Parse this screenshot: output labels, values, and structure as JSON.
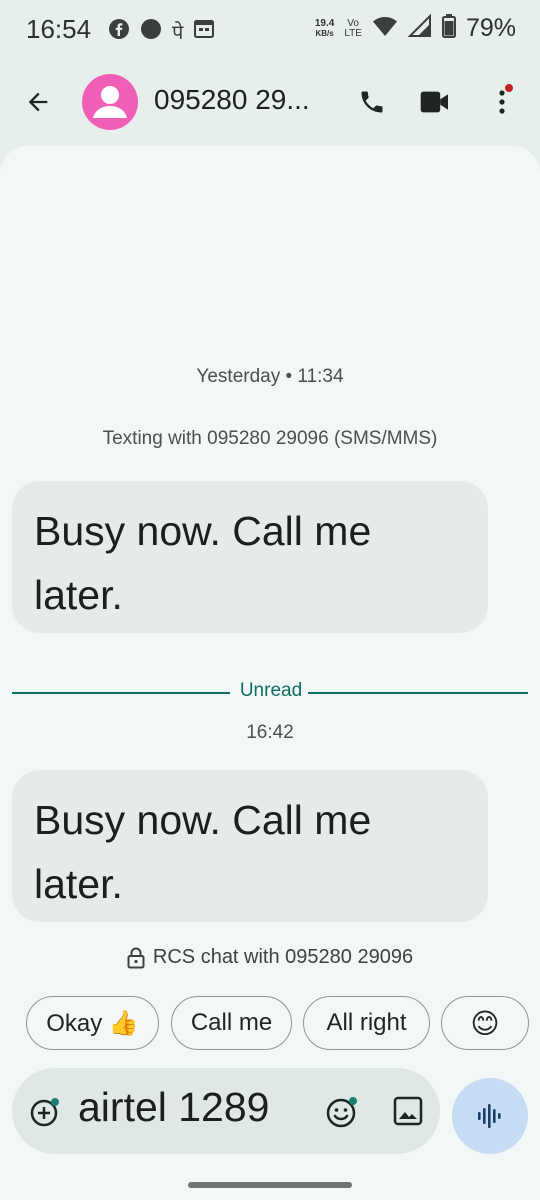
{
  "status_bar": {
    "time": "16:54",
    "net_speed_value": "19.4",
    "net_speed_unit": "KB/s",
    "volte_top": "Vo",
    "volte_bottom": "LTE",
    "battery": "79%",
    "indicator_glyph": "पे",
    "icons": [
      "facebook-icon",
      "dot-icon",
      "phonepe-icon",
      "calendar-icon",
      "wifi-icon",
      "signal-icon",
      "battery-icon"
    ]
  },
  "app_bar": {
    "title": "095280 29...",
    "avatar_color": "#f05fb7",
    "icons": [
      "back-arrow-icon",
      "phone-icon",
      "video-camera-icon",
      "more-vert-icon"
    ]
  },
  "conversation": {
    "first_timestamp": "Yesterday • 11:34",
    "texting_info": "Texting with 095280 29096 (SMS/MMS)",
    "messages": [
      {
        "text": "Busy now. Call me later.",
        "direction": "incoming"
      },
      {
        "text": "Busy now. Call me later.",
        "direction": "incoming"
      }
    ],
    "unread_label": "Unread",
    "second_timestamp": "16:42",
    "rcs_info": "RCS chat with 095280 29096"
  },
  "smart_replies": [
    {
      "label": "Okay 👍"
    },
    {
      "label": "Call me"
    },
    {
      "label": "All right"
    },
    {
      "label": "😊"
    }
  ],
  "compose": {
    "value": "airtel 1289",
    "icons": [
      "add-attachment-icon",
      "emoji-icon",
      "gallery-icon",
      "voice-icon"
    ]
  },
  "colors": {
    "accent": "#116d62",
    "background": "#e7efec",
    "conversation_bg": "#f1f8f5",
    "bubble": "#e4ebe8",
    "voice_button": "#c6dcf3"
  }
}
